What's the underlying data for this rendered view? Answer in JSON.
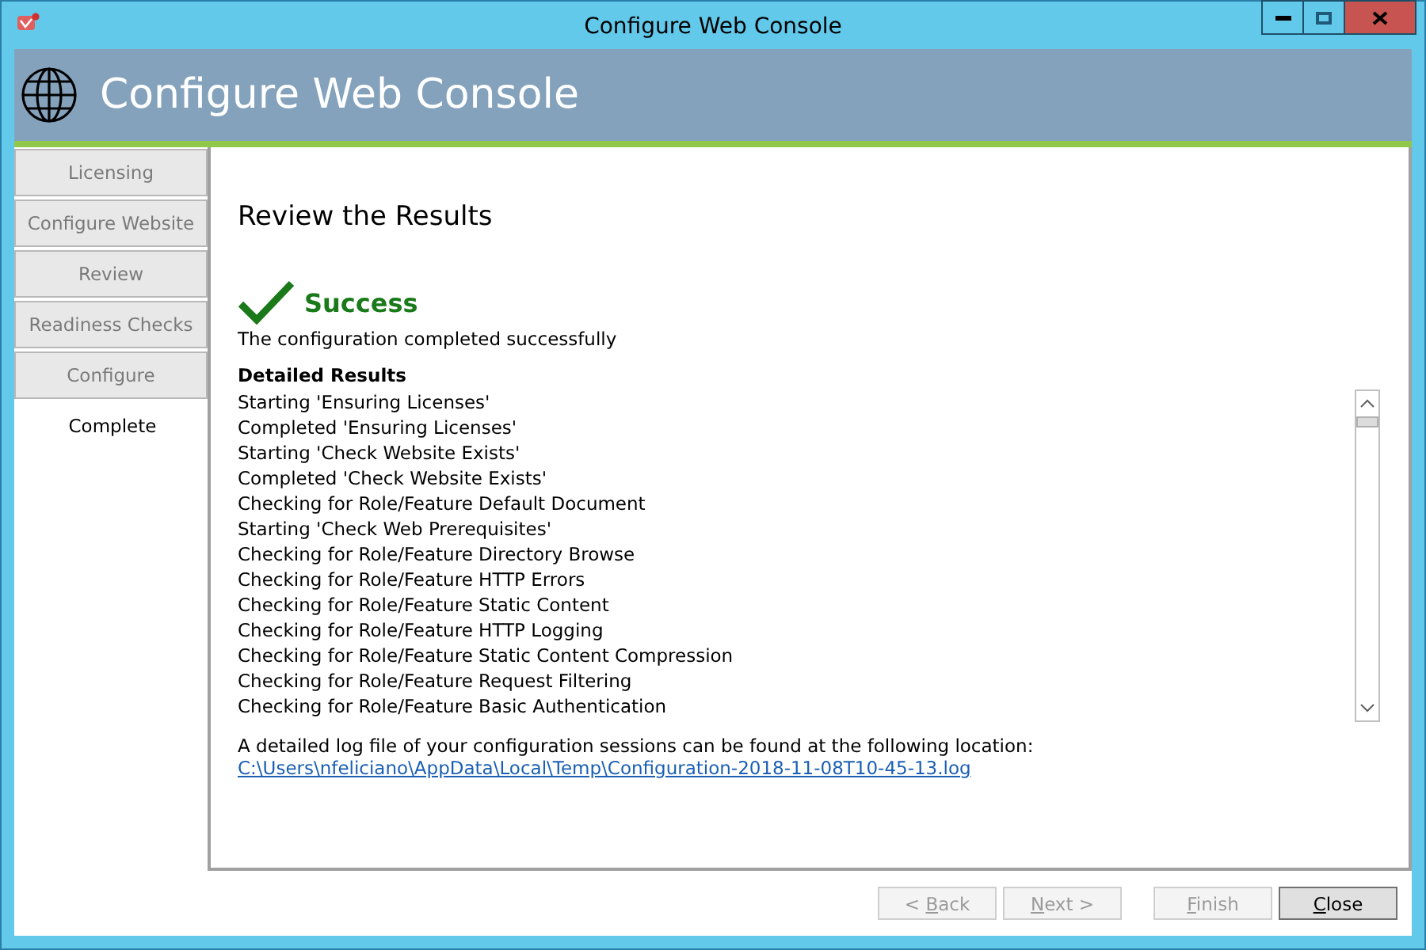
{
  "window": {
    "title": "Configure Web Console"
  },
  "header": {
    "title": "Configure Web Console"
  },
  "steps": [
    {
      "label": "Licensing",
      "selected": false
    },
    {
      "label": "Configure Website",
      "selected": false
    },
    {
      "label": "Review",
      "selected": false
    },
    {
      "label": "Readiness Checks",
      "selected": false
    },
    {
      "label": "Configure",
      "selected": false
    },
    {
      "label": "Complete",
      "selected": true
    }
  ],
  "page": {
    "heading": "Review the Results",
    "status": "Success",
    "message": "The configuration completed successfully",
    "results_label": "Detailed Results",
    "results": [
      "Starting 'Ensuring Licenses'",
      "Completed 'Ensuring Licenses'",
      "Starting 'Check Website Exists'",
      "Completed 'Check Website Exists'",
      "Checking for Role/Feature Default Document",
      "Starting 'Check Web Prerequisites'",
      "Checking for Role/Feature Directory Browse",
      "Checking for Role/Feature HTTP Errors",
      "Checking for Role/Feature Static Content",
      "Checking for Role/Feature HTTP Logging",
      "Checking for Role/Feature Static Content Compression",
      "Checking for Role/Feature Request Filtering",
      "Checking for Role/Feature Basic Authentication"
    ],
    "log_note": "A detailed log file of your configuration sessions can be found at the following location:",
    "log_link": "C:\\Users\\nfeliciano\\AppData\\Local\\Temp\\Configuration-2018-11-08T10-45-13.log"
  },
  "buttons": [
    {
      "before": "< ",
      "access_key": "B",
      "after": "ack",
      "disabled": true
    },
    {
      "access_key": "N",
      "after": "ext >",
      "disabled": true
    },
    {
      "access_key": "F",
      "after": "inish",
      "disabled": true
    },
    {
      "access_key": "C",
      "after": "lose",
      "disabled": false
    }
  ]
}
